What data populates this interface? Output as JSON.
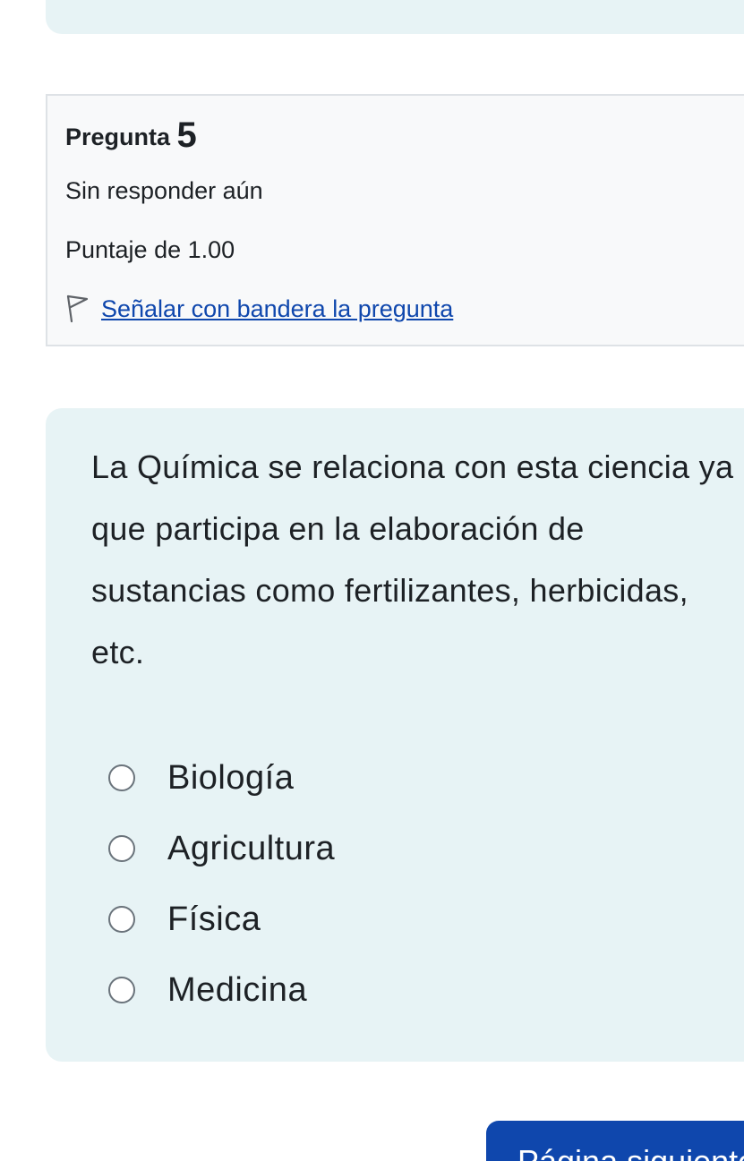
{
  "question": {
    "title_prefix": "Pregunta",
    "number": "5",
    "state": "Sin responder aún",
    "grade": "Puntaje de 1.00",
    "flag_label": "Señalar con bandera la pregunta",
    "text": "La Química se relaciona con esta ciencia ya que participa en la elaboración de sustancias como fertilizantes, herbicidas, etc.",
    "options": [
      {
        "label": "Biología",
        "selected": false
      },
      {
        "label": "Agricultura",
        "selected": false
      },
      {
        "label": "Física",
        "selected": false
      },
      {
        "label": "Medicina",
        "selected": false
      }
    ]
  },
  "navigation": {
    "next_label": "Página siguiente"
  },
  "icons": {
    "flag": "flag-icon",
    "radio": "radio-icon"
  },
  "colors": {
    "link": "#0f47ad",
    "content_background": "#e7f3f5",
    "info_background": "#f8f9fa",
    "button": "#0f47ad"
  }
}
